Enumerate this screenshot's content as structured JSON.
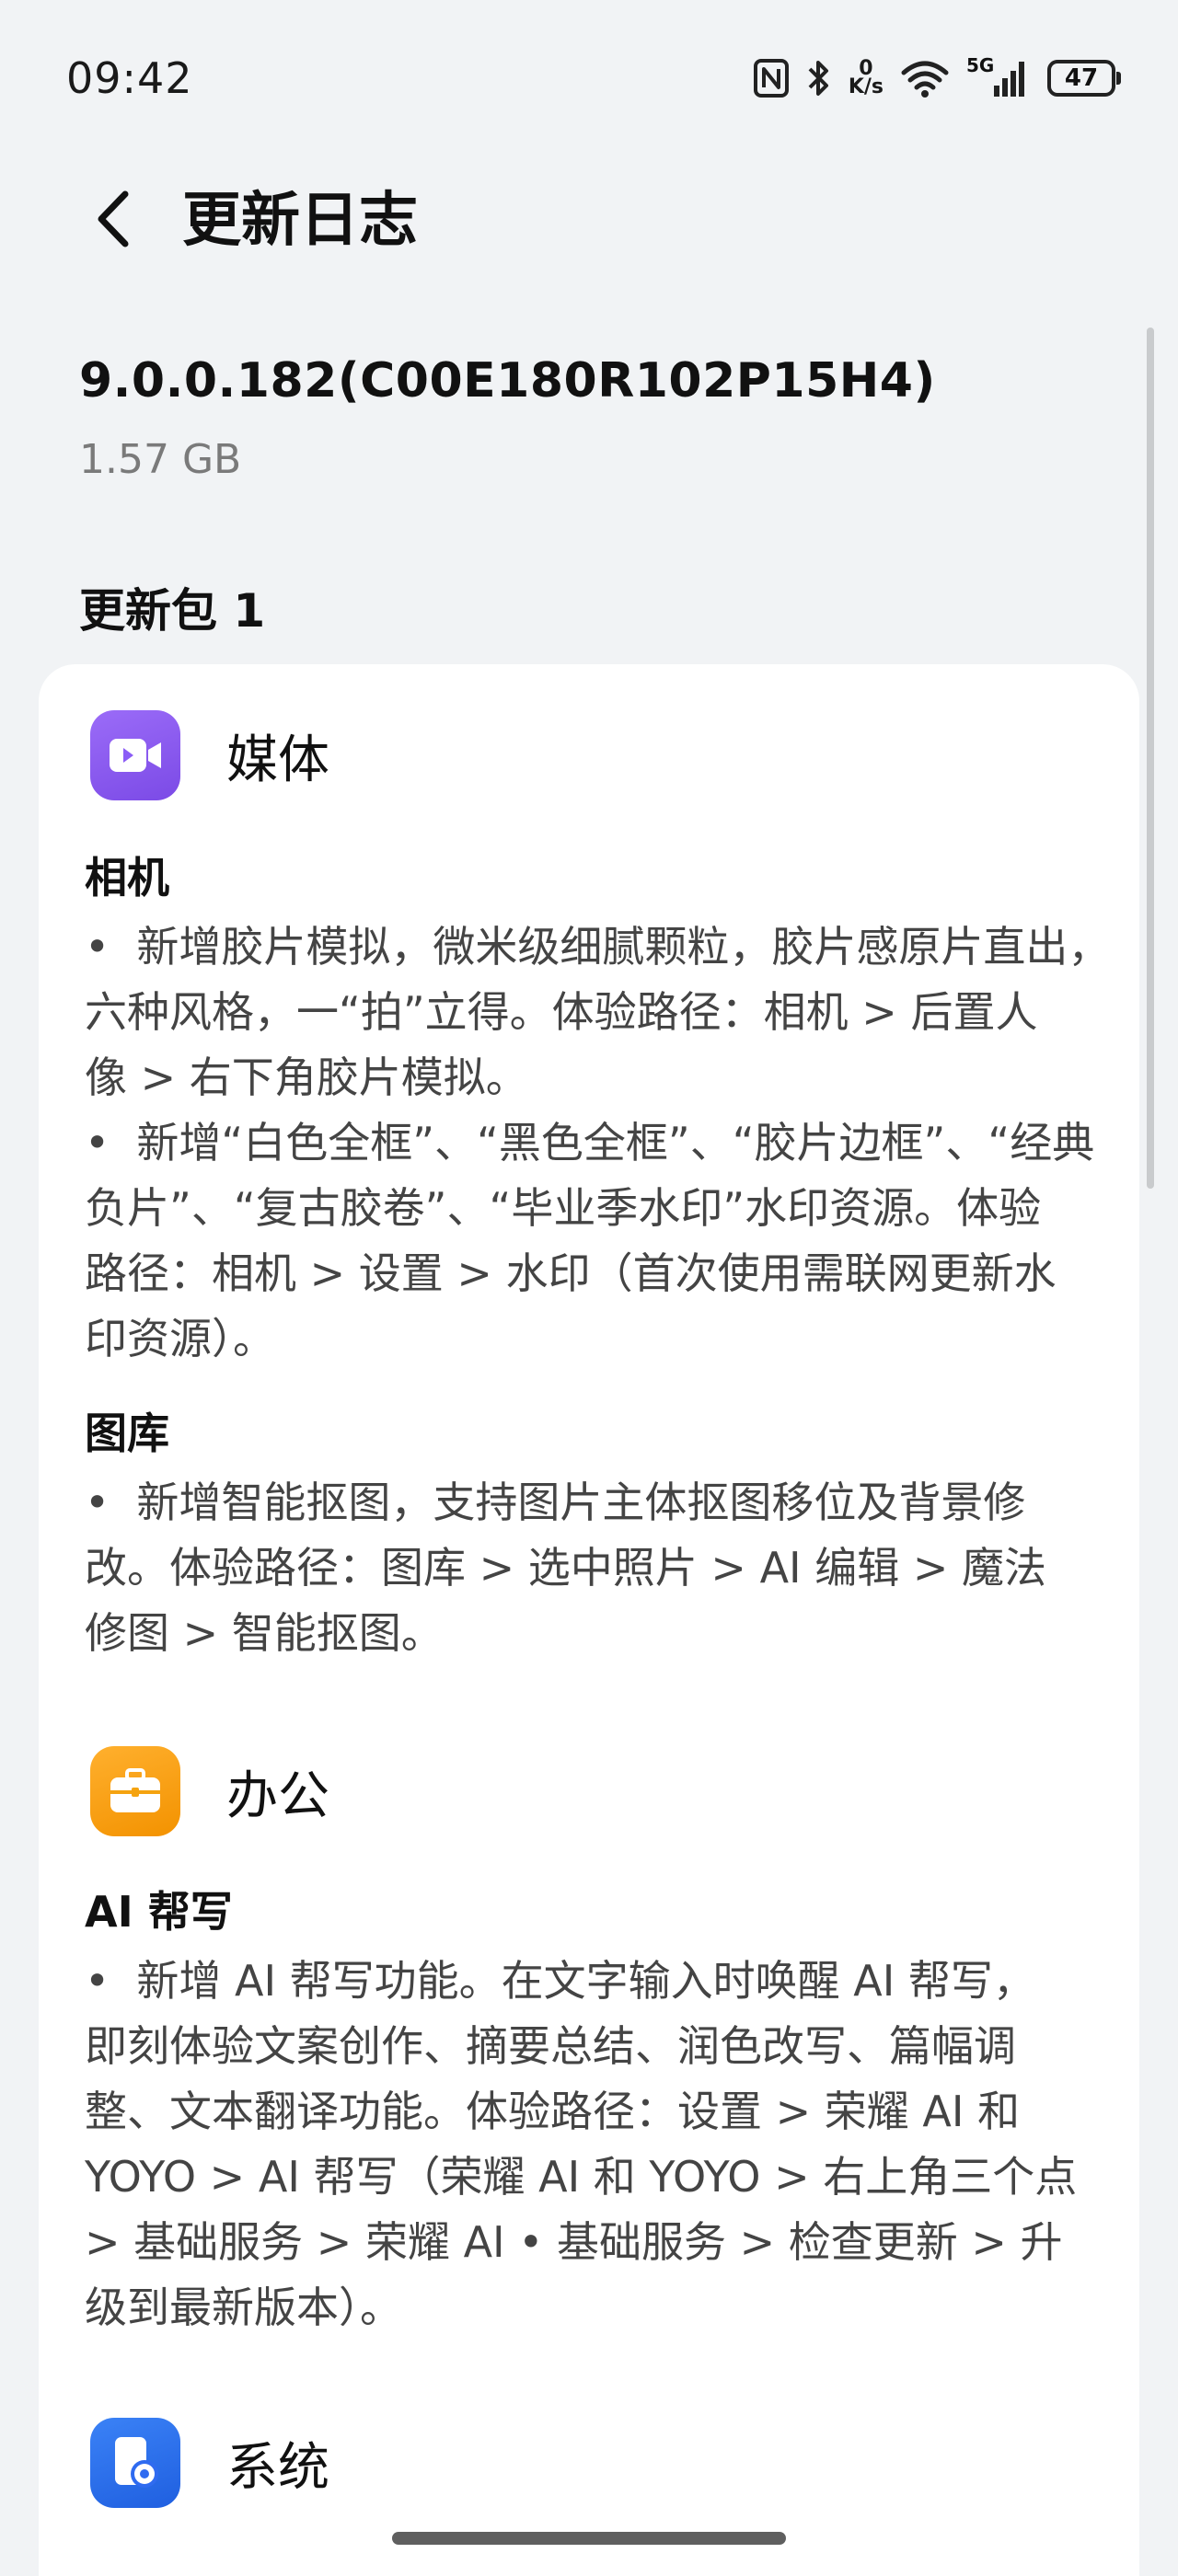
{
  "status_bar": {
    "time": "09:42",
    "net_speed_value": "0",
    "net_speed_unit": "K/s",
    "network_type": "5G",
    "battery": "47"
  },
  "header": {
    "title": "更新日志"
  },
  "version": {
    "number": "9.0.0.182(C00E180R102P15H4)",
    "size": "1.57 GB"
  },
  "package": {
    "label": "更新包 1"
  },
  "sections": [
    {
      "icon": "video-camera-icon",
      "icon_color": "#8b5cf6",
      "title": "媒体",
      "subsections": [
        {
          "title": "相机",
          "text": "•  新增胶片模拟，微米级细腻颗粒，胶片感原片直出，\n六种风格，一“拍”立得。体验路径：相机 > 后置人\n像 > 右下角胶片模拟。\n•  新增“白色全框”、“黑色全框”、“胶片边框”、“经典\n负片”、“复古胶卷”、“毕业季水印”水印资源。体验\n路径：相机 > 设置 > 水印（首次使用需联网更新水\n印资源）。"
        },
        {
          "title": "图库",
          "text": "•  新增智能抠图，支持图片主体抠图移位及背景修\n改。体验路径：图库 > 选中照片 > AI 编辑 > 魔法\n修图 > 智能抠图。"
        }
      ]
    },
    {
      "icon": "briefcase-icon",
      "icon_color": "#f59e0b",
      "title": "办公",
      "subsections": [
        {
          "title": "AI 帮写",
          "text": "•  新增 AI 帮写功能。在文字输入时唤醒 AI 帮写，\n即刻体验文案创作、摘要总结、润色改写、篇幅调\n整、文本翻译功能。体验路径：设置 > 荣耀 AI 和\nYOYO > AI 帮写（荣耀 AI 和 YOYO > 右上角三个点\n> 基础服务 > 荣耀 AI • 基础服务 > 检查更新 > 升\n级到最新版本）。"
        }
      ]
    },
    {
      "icon": "phone-settings-icon",
      "icon_color": "#2f6bf0",
      "title": "系统",
      "subsections": []
    }
  ]
}
